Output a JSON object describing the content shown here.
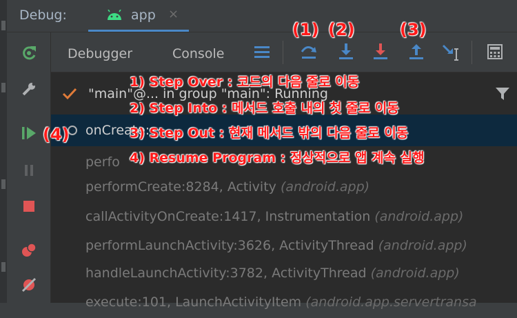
{
  "header": {
    "panel_label": "Debug:",
    "app_tab": "app",
    "close_glyph": "×"
  },
  "tabs": {
    "debugger": "Debugger",
    "console": "Console"
  },
  "frames": {
    "thread": "\"main\"@... in group \"main\": Running",
    "selected": "onCreate:",
    "rows": [
      {
        "text": "perfo",
        "pkg": ""
      },
      {
        "text": "performCreate:8284, Activity",
        "pkg": "(android.app)"
      },
      {
        "text": "callActivityOnCreate:1417, Instrumentation",
        "pkg": "(android.app)"
      },
      {
        "text": "performLaunchActivity:3626, ActivityThread",
        "pkg": "(android.app)"
      },
      {
        "text": "handleLaunchActivity:3782, ActivityThread",
        "pkg": "(android.app)"
      },
      {
        "text": "execute:101, LaunchActivityItem",
        "pkg": "(android.app.servertransa"
      }
    ]
  },
  "annotations": {
    "num1": "(1)",
    "num2": "(2)",
    "num3": "(3)",
    "num4": "(4)",
    "lines": [
      "1) Step Over : 코드의 다음 줄로 이동",
      "2) Step Into : 메서드 호출 내의 첫 줄로 이동",
      "3) Step Out : 현재 메서드 밖의 다음 줄로 이동",
      "4) Resume Program : 정상적으로 앱 계속 실행"
    ]
  },
  "colors": {
    "accent": "#4a88c7",
    "annotation": "#ff1a1a",
    "resume": "#59a869",
    "stop": "#e05555"
  },
  "icons": [
    "rerun-icon",
    "wrench-icon",
    "resume-icon",
    "pause-icon",
    "stop-icon",
    "breakpoints-icon",
    "mute-breakpoints-icon",
    "menu-icon",
    "step-over-icon",
    "step-into-icon",
    "force-step-into-icon",
    "step-out-icon",
    "run-to-cursor-icon",
    "evaluate-icon",
    "filter-icon",
    "check-icon",
    "android-icon"
  ]
}
